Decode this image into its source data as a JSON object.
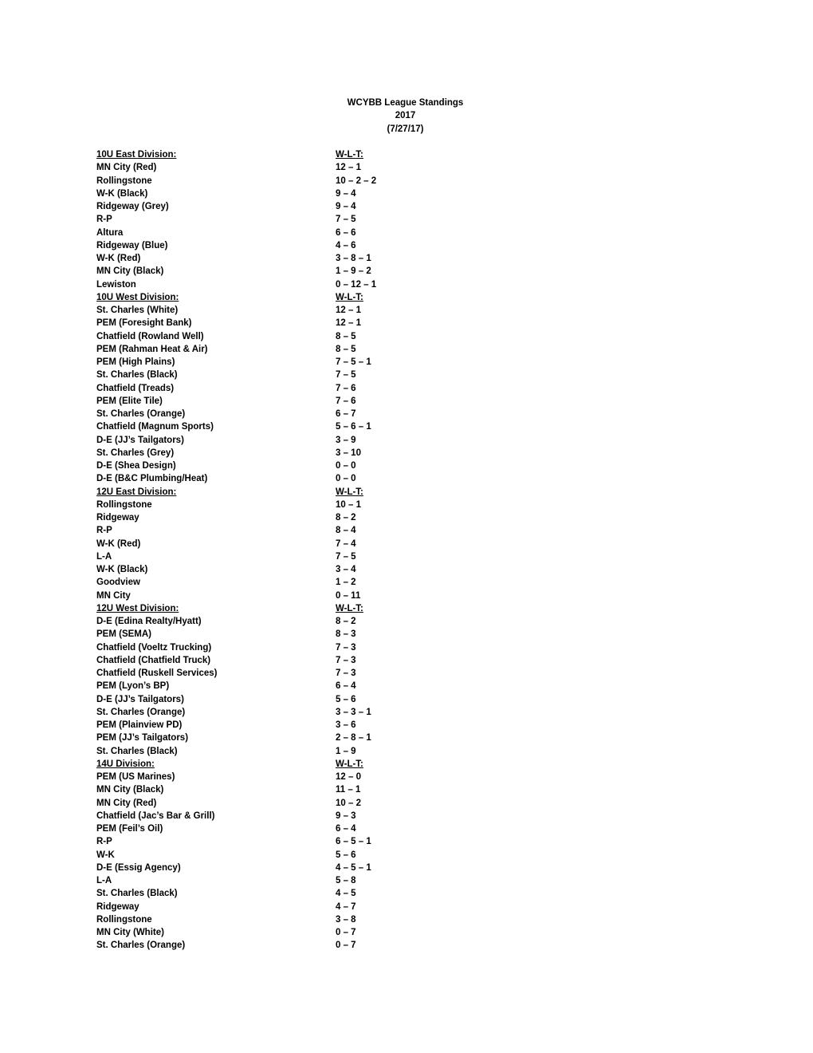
{
  "title": {
    "line1": "WCYBB League Standings",
    "line2": "2017",
    "line3": "(7/27/17)"
  },
  "divisions": [
    {
      "name": "10U East Division:",
      "record_header": "W-L-T:",
      "teams": [
        {
          "team": "MN City (Red)",
          "record": "12 – 1"
        },
        {
          "team": "Rollingstone",
          "record": "10 – 2 – 2"
        },
        {
          "team": "W-K (Black)",
          "record": "9 – 4"
        },
        {
          "team": "Ridgeway (Grey)",
          "record": "9 – 4"
        },
        {
          "team": "R-P",
          "record": "7 – 5"
        },
        {
          "team": "Altura",
          "record": "6 – 6"
        },
        {
          "team": "Ridgeway (Blue)",
          "record": "4 – 6"
        },
        {
          "team": "W-K (Red)",
          "record": "3 – 8 – 1"
        },
        {
          "team": "MN City (Black)",
          "record": "1 – 9 – 2"
        },
        {
          "team": "Lewiston",
          "record": "0 – 12 – 1"
        }
      ]
    },
    {
      "name": "10U West Division:",
      "record_header": "W-L-T:",
      "teams": [
        {
          "team": "St. Charles (White)",
          "record": "12 – 1"
        },
        {
          "team": "PEM (Foresight Bank)",
          "record": "12 – 1"
        },
        {
          "team": "Chatfield (Rowland Well)",
          "record": "8 – 5"
        },
        {
          "team": "PEM (Rahman Heat & Air)",
          "record": "8 – 5"
        },
        {
          "team": "PEM (High Plains)",
          "record": "7 – 5 – 1"
        },
        {
          "team": "St. Charles (Black)",
          "record": "7 – 5"
        },
        {
          "team": "Chatfield (Treads)",
          "record": "7 – 6"
        },
        {
          "team": "PEM (Elite Tile)",
          "record": "7 – 6"
        },
        {
          "team": "St. Charles (Orange)",
          "record": "6 – 7"
        },
        {
          "team": "Chatfield (Magnum Sports)",
          "record": "5 – 6 – 1"
        },
        {
          "team": "D-E (JJ’s Tailgators)",
          "record": "3 – 9"
        },
        {
          "team": "St. Charles (Grey)",
          "record": "3 – 10"
        },
        {
          "team": "D-E (Shea Design)",
          "record": "0 – 0"
        },
        {
          "team": "D-E (B&C Plumbing/Heat)",
          "record": "0 – 0"
        }
      ]
    },
    {
      "name": "12U East Division:",
      "record_header": "W-L-T:",
      "teams": [
        {
          "team": "Rollingstone",
          "record": "10 – 1"
        },
        {
          "team": "Ridgeway",
          "record": "8 – 2"
        },
        {
          "team": "R-P",
          "record": "8 – 4"
        },
        {
          "team": "W-K (Red)",
          "record": "7 – 4"
        },
        {
          "team": "L-A",
          "record": "7 – 5"
        },
        {
          "team": "W-K (Black)",
          "record": "3 – 4"
        },
        {
          "team": "Goodview",
          "record": "1 – 2"
        },
        {
          "team": "MN City",
          "record": "0 – 11"
        }
      ]
    },
    {
      "name": "12U West Division:",
      "record_header": "W-L-T:",
      "teams": [
        {
          "team": "D-E (Edina Realty/Hyatt)",
          "record": "8 – 2"
        },
        {
          "team": "PEM (SEMA)",
          "record": "8 – 3"
        },
        {
          "team": "Chatfield (Voeltz Trucking)",
          "record": "7 – 3"
        },
        {
          "team": "Chatfield (Chatfield Truck)",
          "record": "7 – 3"
        },
        {
          "team": "Chatfield (Ruskell Services)",
          "record": "7 – 3"
        },
        {
          "team": "PEM (Lyon’s BP)",
          "record": "6 – 4"
        },
        {
          "team": "D-E (JJ’s Tailgators)",
          "record": "5 – 6"
        },
        {
          "team": "St. Charles (Orange)",
          "record": "3 – 3 – 1"
        },
        {
          "team": "PEM (Plainview PD)",
          "record": "3 – 6"
        },
        {
          "team": "PEM (JJ’s Tailgators)",
          "record": "2 – 8 – 1"
        },
        {
          "team": "St. Charles (Black)",
          "record": "1 – 9"
        }
      ]
    },
    {
      "name": "14U Division:",
      "record_header": "W-L-T:",
      "teams": [
        {
          "team": "PEM (US Marines)",
          "record": "12 – 0"
        },
        {
          "team": "MN City (Black)",
          "record": "11 – 1"
        },
        {
          "team": "MN City (Red)",
          "record": "10 – 2"
        },
        {
          "team": "Chatfield (Jac’s Bar & Grill)",
          "record": "9 – 3"
        },
        {
          "team": "PEM (Feil’s Oil)",
          "record": "6 – 4"
        },
        {
          "team": "R-P",
          "record": "6 – 5 – 1"
        },
        {
          "team": "W-K",
          "record": "5 – 6"
        },
        {
          "team": "D-E (Essig Agency)",
          "record": "4 – 5 – 1"
        },
        {
          "team": "L-A",
          "record": "5 – 8"
        },
        {
          "team": "St. Charles (Black)",
          "record": "4 – 5"
        },
        {
          "team": "Ridgeway",
          "record": "4 – 7"
        },
        {
          "team": "Rollingstone",
          "record": "3 – 8"
        },
        {
          "team": "MN City (White)",
          "record": "0 – 7"
        },
        {
          "team": "St. Charles (Orange)",
          "record": "0 – 7"
        }
      ]
    }
  ]
}
